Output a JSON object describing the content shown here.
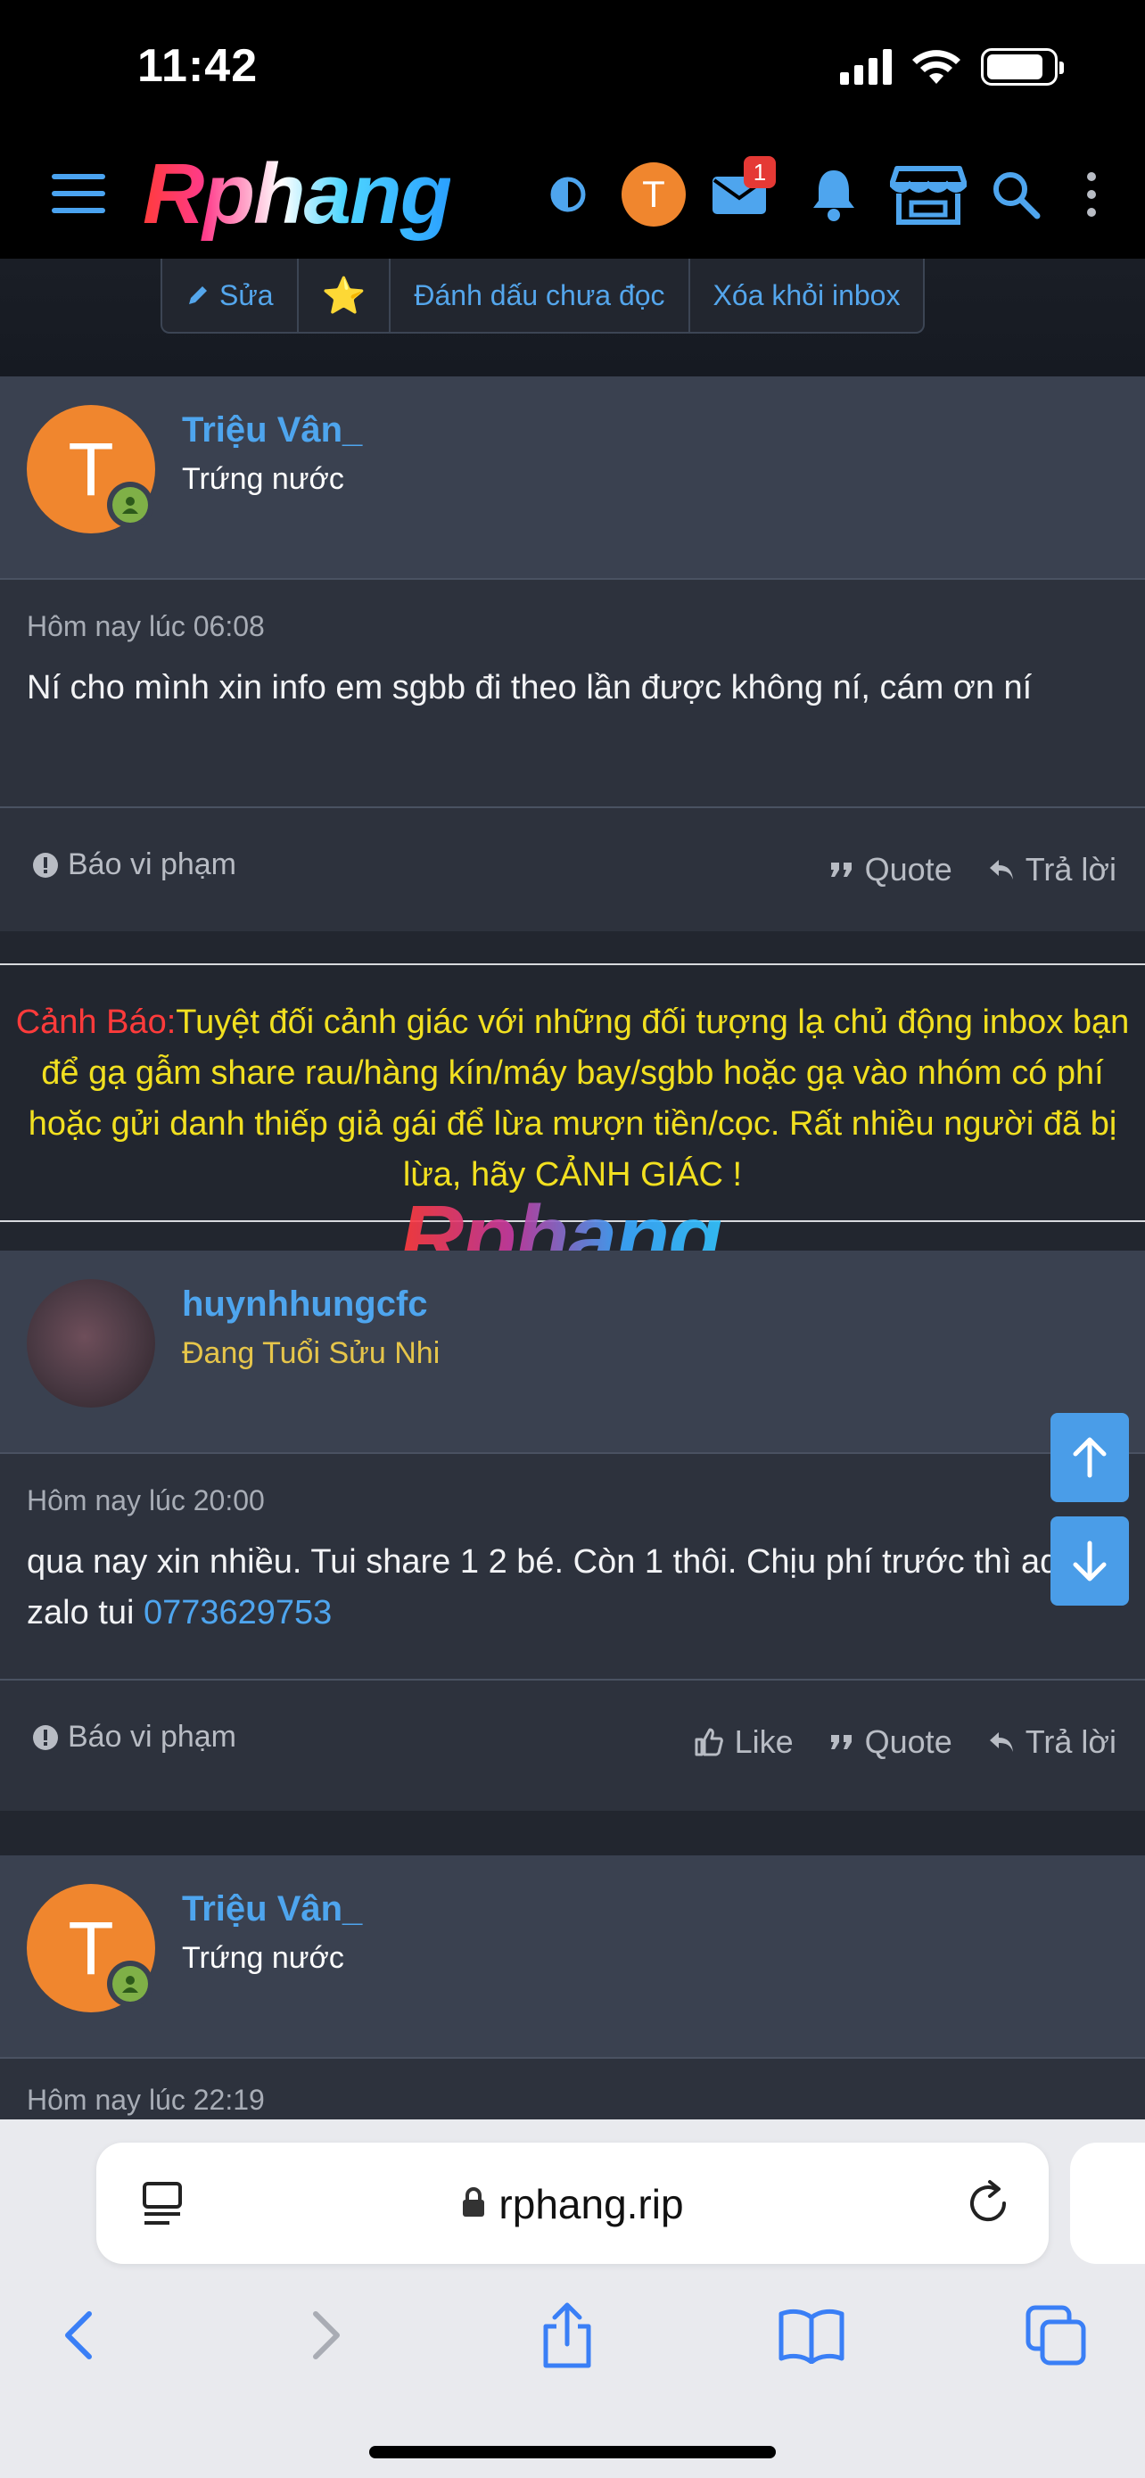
{
  "status_bar": {
    "time": "11:42"
  },
  "header": {
    "logo": "Rphang",
    "avatar_letter": "T",
    "inbox_badge": "1",
    "icons": [
      "menu-icon",
      "contrast-icon",
      "mail-icon",
      "bell-icon",
      "store-icon",
      "search-icon",
      "more-vertical-icon"
    ]
  },
  "thread_toolbar": {
    "edit": "Sửa",
    "star": "⭐",
    "mark_unread": "Đánh dấu chưa đọc",
    "remove_inbox": "Xóa khỏi inbox"
  },
  "posts": [
    {
      "author": "Triệu Vân_",
      "avatar_letter": "T",
      "user_title": "Trứng nước",
      "time": "Hôm nay lúc 06:08",
      "body": "Ní cho mình xin info em sgbb đi theo lần được không ní, cám ơn ní",
      "report": "Báo vi phạm",
      "quote": "Quote",
      "reply": "Trả lời"
    },
    {
      "author": "huynhhungcfc",
      "user_title": "Đang Tuổi Sửu Nhi",
      "time": "Hôm nay lúc 20:00",
      "body": "qua nay xin nhiều. Tui share 1 2 bé. Còn 1 thôi. Chịu phí trước thì add zalo tui ",
      "phone": "0773629753",
      "report": "Báo vi phạm",
      "like": "Like",
      "quote": "Quote",
      "reply": "Trả lời"
    },
    {
      "author": "Triệu Vân_",
      "avatar_letter": "T",
      "user_title": "Trứng nước",
      "time": "Hôm nay lúc 22:19"
    }
  ],
  "warning": {
    "label": "Cảnh Báo:",
    "text": "Tuyệt đối cảnh giác với những đối tượng lạ chủ động inbox bạn để gạ gẫm share rau/hàng kín/máy bay/sgbb hoặc gạ vào nhóm có phí hoặc gửi danh thiếp giả gái để lừa mượn tiền/cọc. Rất nhiều người đã bị lừa, hãy CẢNH GIÁC !",
    "watermark": "Rphang"
  },
  "browser": {
    "url": "rphang.rip"
  },
  "colors": {
    "accent": "#4ea5ee",
    "warning_text": "#f2e020",
    "warning_label": "#ff3b3b",
    "avatar": "#f0862e"
  }
}
